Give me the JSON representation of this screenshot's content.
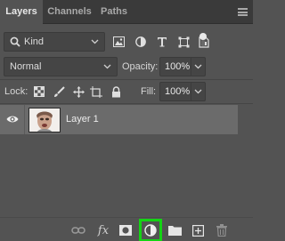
{
  "tabs": [
    {
      "label": "Layers",
      "active": true
    },
    {
      "label": "Channels",
      "active": false
    },
    {
      "label": "Paths",
      "active": false
    }
  ],
  "filter": {
    "kind_label": "Kind",
    "icons": [
      "pixel-filter-icon",
      "adjustment-filter-icon",
      "type-filter-icon",
      "shape-filter-icon",
      "smart-object-filter-icon"
    ]
  },
  "blend": {
    "mode": "Normal",
    "opacity_label": "Opacity:",
    "opacity_value": "100%"
  },
  "lock": {
    "label": "Lock:",
    "icons": [
      "lock-transparent-pixels-icon",
      "lock-image-pixels-icon",
      "lock-position-icon",
      "lock-artboard-icon",
      "lock-all-icon"
    ],
    "fill_label": "Fill:",
    "fill_value": "100%"
  },
  "layers": [
    {
      "name": "Layer 1",
      "visible": true
    }
  ],
  "bottom_icons": [
    "link-layers-icon",
    "layer-style-icon",
    "layer-mask-icon",
    "adjustment-layer-icon",
    "group-folder-icon",
    "new-layer-icon",
    "trash-icon"
  ],
  "colors": {
    "panel_bg": "#535353",
    "tab_bar_bg": "#3a3a3a",
    "selected_layer_bg": "#6b6b6b",
    "highlight": "#14d414"
  }
}
